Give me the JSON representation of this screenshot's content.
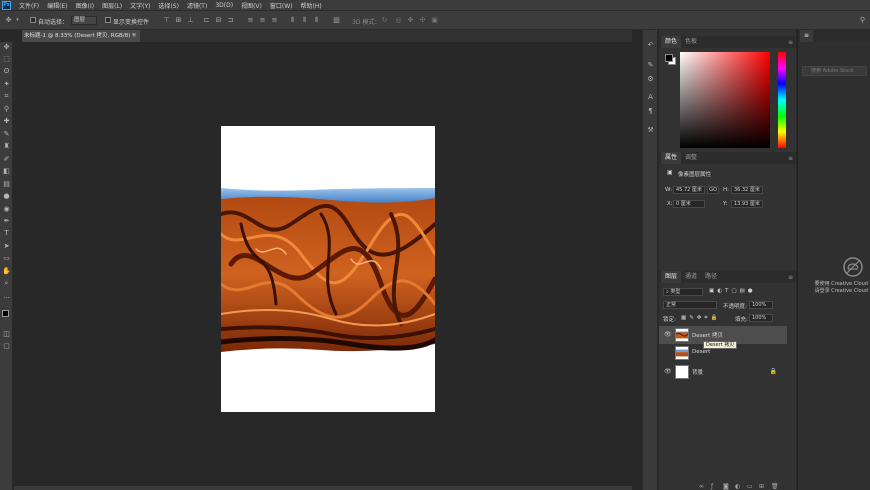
{
  "app": {
    "logo": "Ps"
  },
  "menu": [
    "文件(F)",
    "编辑(E)",
    "图像(I)",
    "图层(L)",
    "文字(Y)",
    "选择(S)",
    "滤镜(T)",
    "3D(D)",
    "视图(V)",
    "窗口(W)",
    "帮助(H)"
  ],
  "options": {
    "auto_select_label": "自动选择：",
    "auto_select_value": "图层",
    "show_transform_label": "显示变换控件",
    "mode_3d_label": "3D 模式："
  },
  "document": {
    "tab_title": "未标题-1 @ 8.33% (Desert 拷贝, RGB/8) *",
    "close_glyph": "×"
  },
  "color_panel": {
    "tabs": [
      "颜色",
      "色板"
    ],
    "foreground": "#000000",
    "background": "#ffffff"
  },
  "properties_panel": {
    "tabs": [
      "属性",
      "调整"
    ],
    "layer_type": "像素图层属性",
    "w_label": "W:",
    "w_value": "45.72 厘米",
    "go_label": "GO",
    "h_label": "H:",
    "h_value": "36.32 厘米",
    "x_label": "X:",
    "x_value": "0 厘米",
    "y_label": "Y:",
    "y_value": "13.93 厘米"
  },
  "layers_panel": {
    "tabs": [
      "图层",
      "通道",
      "路径"
    ],
    "filter_kind": "类型",
    "blend_mode": "正常",
    "opacity_label": "不透明度:",
    "opacity_value": "100%",
    "lock_label": "锁定:",
    "fill_label": "填充:",
    "fill_value": "100%",
    "layers": [
      {
        "name": "Desert 拷贝",
        "visible": true,
        "selected": true
      },
      {
        "name": "Desert",
        "visible": false,
        "selected": false
      },
      {
        "name": "背景",
        "visible": true,
        "selected": false,
        "locked": true
      }
    ],
    "tooltip": "Desert 拷贝",
    "bottom_icons": [
      "link-icon",
      "fx-icon",
      "mask-icon",
      "adjustment-icon",
      "group-icon",
      "new-layer-icon",
      "trash-icon"
    ]
  },
  "libraries_panel": {
    "search_placeholder": "搜索 Adobe Stock",
    "cc_line1": "要使用 Creative Cloud",
    "cc_line2": "请登录 Creative Cloud"
  },
  "colors": {
    "accent": "#31a8ff",
    "selected_row": "#4d4d4d",
    "canvas_bg": "#282828"
  }
}
